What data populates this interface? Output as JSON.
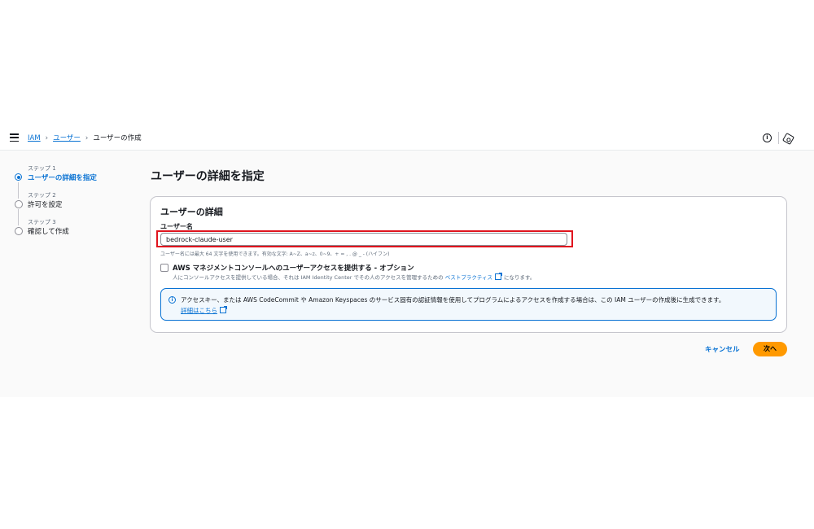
{
  "breadcrumb": {
    "items": [
      "IAM",
      "ユーザー"
    ],
    "current": "ユーザーの作成"
  },
  "steps": [
    {
      "num": "ステップ 1",
      "title": "ユーザーの詳細を指定"
    },
    {
      "num": "ステップ 2",
      "title": "許可を設定"
    },
    {
      "num": "ステップ 3",
      "title": "確認して作成"
    }
  ],
  "page": {
    "title": "ユーザーの詳細を指定"
  },
  "card": {
    "title": "ユーザーの詳細",
    "username_label": "ユーザー名",
    "username_value": "bedrock-claude-user",
    "constraint": "ユーザー名には最大 64 文字を使用できます。有効な文字: A~Z、a~z、0~9、+ = , . @ _ - (ハイフン)",
    "console_label": "AWS マネジメントコンソールへのユーザーアクセスを提供する - オプション",
    "console_desc": "人にコンソールアクセスを提供している場合、それは IAM Identity Center でその人のアクセスを管理するための",
    "console_link": "ベストプラクティス",
    "console_desc_end": "になります。"
  },
  "alert": {
    "text": "アクセスキー、または AWS CodeCommit や Amazon Keyspaces のサービス固有の認証情報を使用してプログラムによるアクセスを作成する場合は、この IAM ユーザーの作成後に生成できます。",
    "link": "詳細はこちら"
  },
  "actions": {
    "cancel": "キャンセル",
    "next": "次へ"
  },
  "colors": {
    "accent": "#0972d3",
    "primary_button": "#ff9900",
    "highlight": "#e0141e"
  }
}
